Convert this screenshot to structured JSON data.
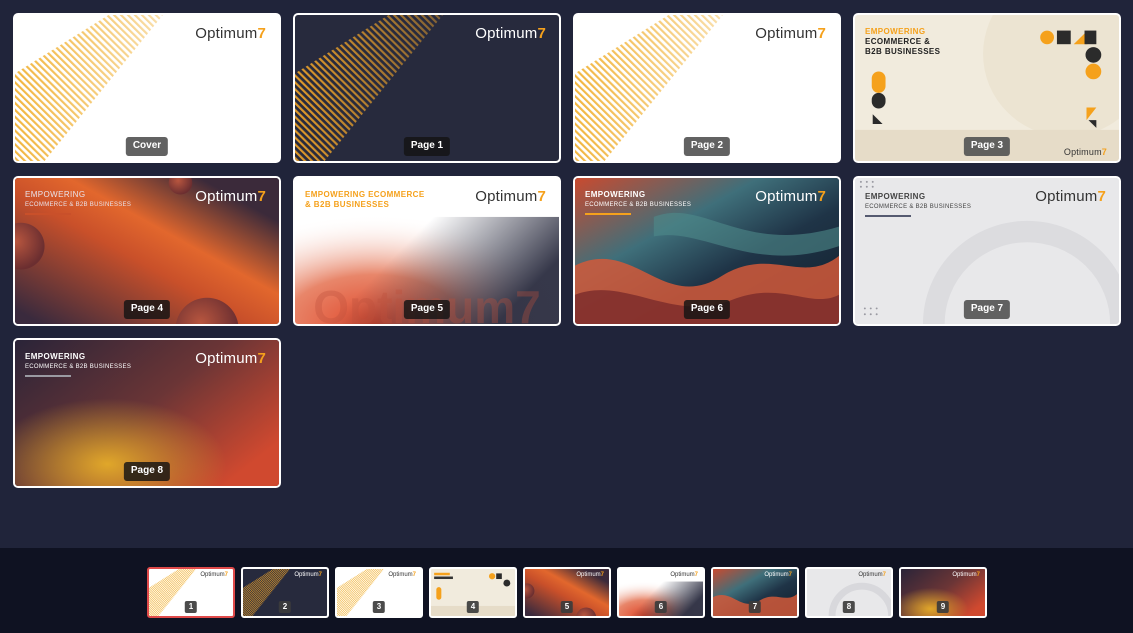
{
  "brand": {
    "name": "Optimum",
    "digit": "7",
    "accent": "#f5a11c"
  },
  "pages": [
    {
      "label": "Cover",
      "theme": "light-lines"
    },
    {
      "label": "Page 1",
      "theme": "dark-lines"
    },
    {
      "label": "Page 2",
      "theme": "light-lines"
    },
    {
      "label": "Page 3",
      "theme": "beige-shapes",
      "headline1": "EMPOWERING",
      "headline2": "ECOMMERCE &",
      "headline3": "B2B BUSINESSES"
    },
    {
      "label": "Page 4",
      "theme": "dark-orange",
      "headline1": "EMPOWERING",
      "headline2": "ECOMMERCE & B2B BUSINESSES"
    },
    {
      "label": "Page 5",
      "theme": "white-gradient",
      "headline1": "EMPOWERING ECOMMERCE",
      "headline2": "& B2B BUSINESSES",
      "watermark": "Optimum7"
    },
    {
      "label": "Page 6",
      "theme": "waves",
      "headline1": "EMPOWERING",
      "headline2": "ECOMMERCE & B2B BUSINESSES"
    },
    {
      "label": "Page 7",
      "theme": "light-grey",
      "headline1": "EMPOWERING",
      "headline2": "ECOMMERCE & B2B BUSINESSES"
    },
    {
      "label": "Page 8",
      "theme": "dark-gold",
      "headline1": "EMPOWERING",
      "headline2": "ECOMMERCE & B2B BUSINESSES"
    }
  ],
  "thumbnails": [
    "1",
    "2",
    "3",
    "4",
    "5",
    "6",
    "7",
    "8",
    "9"
  ],
  "active_thumbnail": 0,
  "colors": {
    "background": "#20243a",
    "strip": "#0f1222",
    "active_border": "#e04a4a"
  }
}
